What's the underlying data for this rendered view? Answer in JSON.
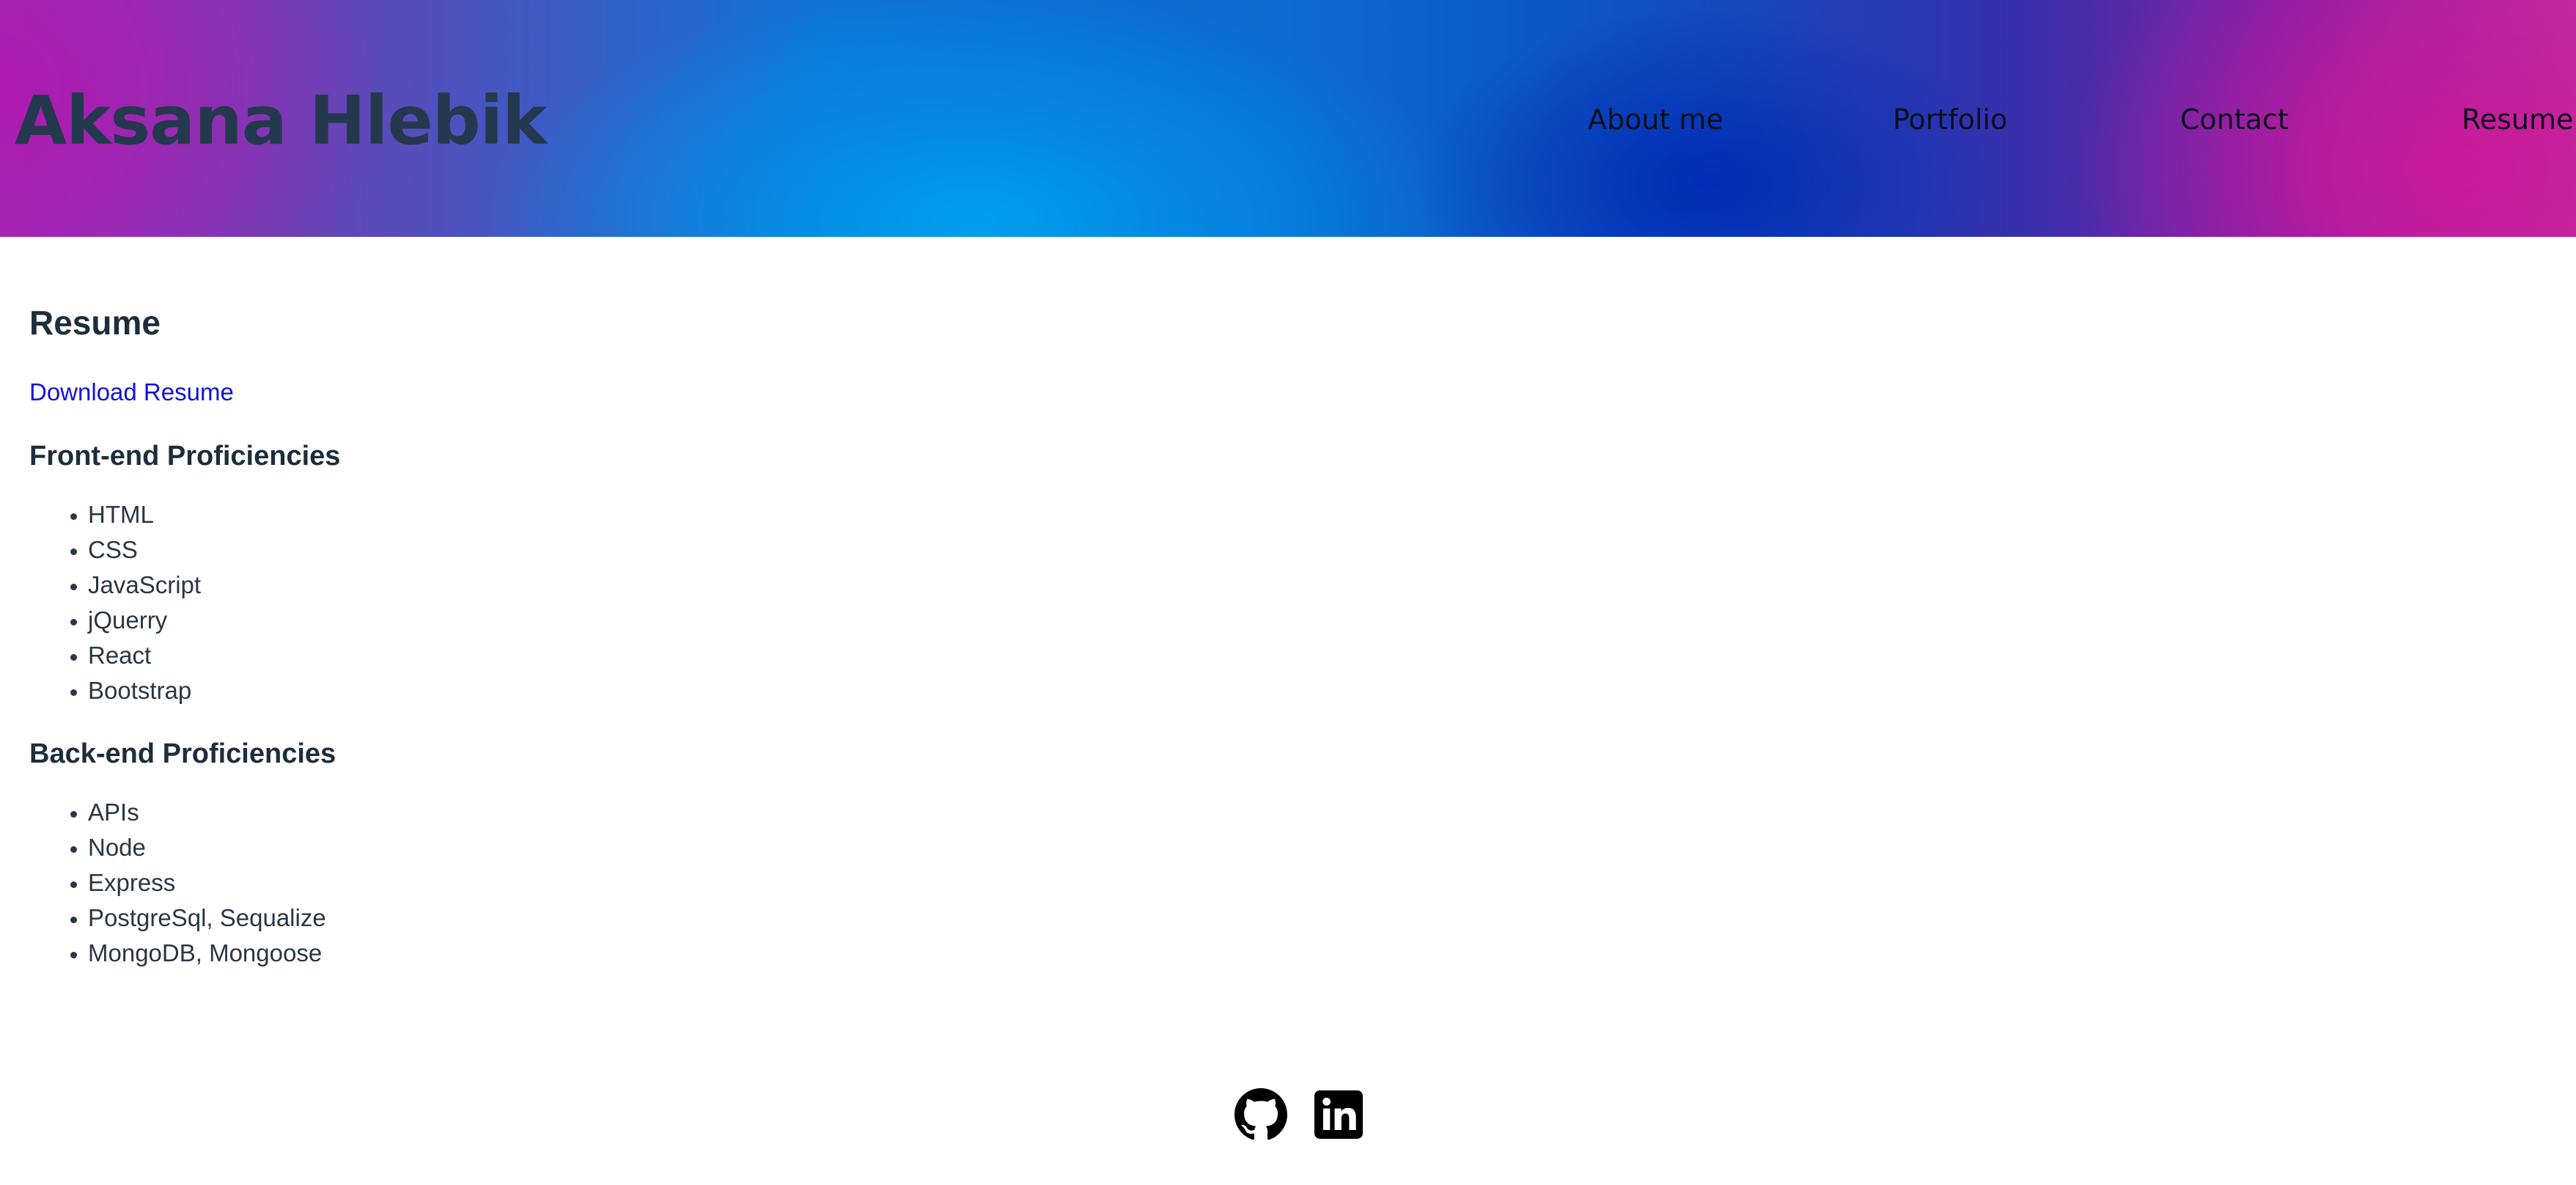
{
  "header": {
    "brand": "Aksana Hlebik",
    "nav": [
      {
        "label": "About me"
      },
      {
        "label": "Portfolio"
      },
      {
        "label": "Contact"
      },
      {
        "label": "Resume"
      }
    ]
  },
  "main": {
    "title": "Resume",
    "download_link": "Download Resume",
    "frontend": {
      "title": "Front-end Proficiencies",
      "items": [
        "HTML",
        "CSS",
        "JavaScript",
        "jQuerry",
        "React",
        "Bootstrap"
      ]
    },
    "backend": {
      "title": "Back-end Proficiencies",
      "items": [
        "APIs",
        "Node",
        "Express",
        "PostgreSql, Sequalize",
        "MongoDB, Mongoose"
      ]
    }
  },
  "footer": {
    "icons": [
      "github-icon",
      "linkedin-icon"
    ]
  },
  "colors": {
    "link": "#1111dd",
    "text": "#1e2d3b",
    "brand_text": "#24384e"
  }
}
